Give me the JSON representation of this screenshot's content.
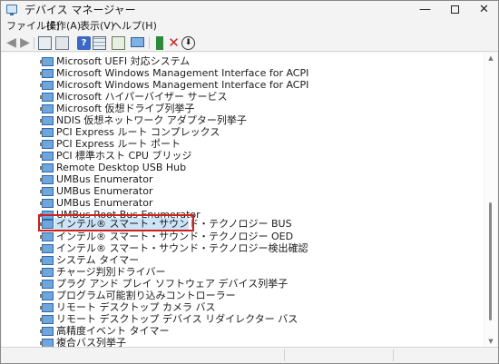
{
  "window": {
    "title": "デバイス マネージャー"
  },
  "menubar": {
    "items": [
      "ファイル(F)",
      "操作(A)",
      "表示(V)",
      "ヘルプ(H)"
    ]
  },
  "toolbar": {
    "icons": [
      "back-icon",
      "forward-icon",
      "properties-icon",
      "show-hide-tree-icon",
      "help-icon",
      "grid-view-icon",
      "refresh-icon",
      "monitor-icon",
      "update-driver-icon",
      "uninstall-icon",
      "download-icon"
    ]
  },
  "tree": {
    "items": [
      "Microsoft UEFI 対応システム",
      "Microsoft Windows Management Interface for ACPI",
      "Microsoft Windows Management Interface for ACPI",
      "Microsoft ハイパーバイザー サービス",
      "Microsoft 仮想ドライブ列挙子",
      "NDIS 仮想ネットワーク アダプター列挙子",
      "PCI Express ルート コンプレックス",
      "PCI Express ルート ポート",
      "PCI 標準ホスト CPU ブリッジ",
      "Remote Desktop USB Hub",
      "UMBus Enumerator",
      "UMBus Enumerator",
      "UMBus Enumerator",
      "UMBus Root Bus Enumerator",
      "インテル® スマート・サウンド・テクノロジー BUS",
      "インテル® スマート・サウンド・テクノロジー OED",
      "インテル® スマート・サウンド・テクノロジー検出確認",
      "システム タイマー",
      "チャージ判別ドライバー",
      "プラグ アンド プレイ ソフトウェア デバイス列挙子",
      "プログラム可能割り込みコントローラー",
      "リモート デスクトップ カメラ バス",
      "リモート デスクトップ デバイス リダイレクター バス",
      "高精度イベント タイマー",
      "複合バス列挙子"
    ],
    "selected_index": 14
  },
  "colors": {
    "highlight_border": "#d0201a",
    "selection_bg": "#cce4f7",
    "device_icon": "#6fa7dd"
  }
}
